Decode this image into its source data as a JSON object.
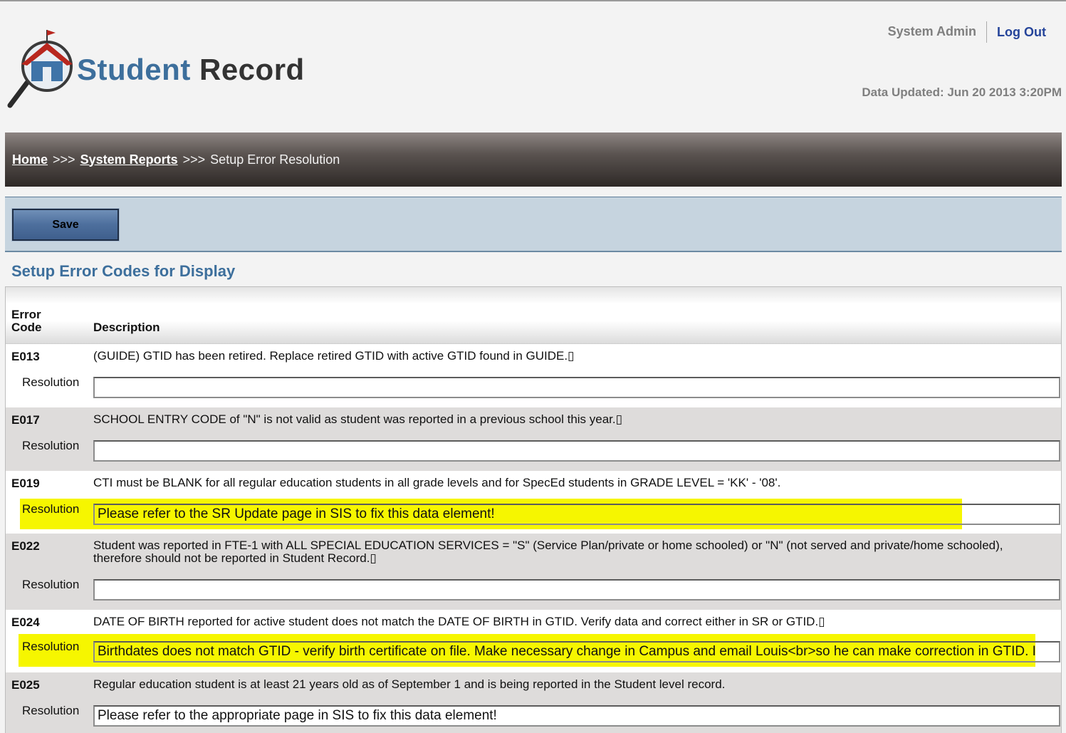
{
  "app": {
    "logo_word1": "Student",
    "logo_word2": "Record",
    "user_name": "System Admin",
    "logout_label": "Log Out",
    "data_updated": "Data Updated: Jun 20 2013 3:20PM"
  },
  "breadcrumb": {
    "home": "Home",
    "sep": ">>>",
    "reports": "System Reports",
    "current": "Setup Error Resolution"
  },
  "toolbar": {
    "save_label": "Save"
  },
  "section": {
    "title": "Setup Error Codes for Display"
  },
  "table": {
    "col_code_line1": "Error",
    "col_code_line2": "Code",
    "col_desc": "Description",
    "resolution_label": "Resolution",
    "rows": [
      {
        "code": "E013",
        "description": "(GUIDE) GTID has been retired. Replace retired GTID with active GTID found in GUIDE.▯",
        "resolution": ""
      },
      {
        "code": "E017",
        "description": "SCHOOL ENTRY CODE of \"N\" is not valid as student was reported in a previous school this year.▯",
        "resolution": ""
      },
      {
        "code": "E019",
        "description": "CTI must be BLANK for all regular education students in all grade levels and for SpecEd students in GRADE LEVEL = 'KK' - '08'.",
        "resolution": "Please refer to the SR Update page in SIS to fix this data element!"
      },
      {
        "code": "E022",
        "description": "Student was reported in FTE-1 with ALL SPECIAL EDUCATION SERVICES = \"S\" (Service Plan/private or home schooled) or \"N\" (not served and private/home schooled), therefore should not be reported in Student Record.▯",
        "resolution": ""
      },
      {
        "code": "E024",
        "description": "DATE OF BIRTH reported for active student does not match the DATE OF BIRTH in GTID. Verify data and correct either in SR or GTID.▯",
        "resolution": "Birthdates does not match GTID - verify birth certificate on file. Make necessary change in Campus and email Louis<br>so he can make correction in GTID. I"
      },
      {
        "code": "E025",
        "description": "Regular education student is at least 21 years old as of September 1 and is being reported in the Student level record.",
        "resolution": "Please refer to the appropriate page in SIS to fix this data element!"
      }
    ]
  }
}
